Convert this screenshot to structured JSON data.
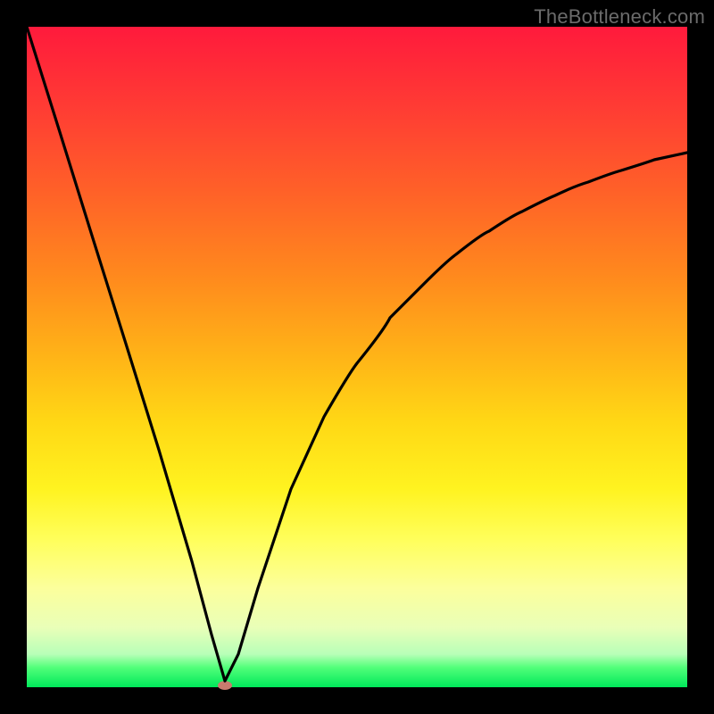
{
  "watermark": "TheBottleneck.com",
  "colors": {
    "frame_bg": "#000000",
    "curve_stroke": "#000000",
    "dot_fill": "#c97b6e",
    "gradient_top": "#ff1a3c",
    "gradient_bottom": "#00e85a"
  },
  "chart_data": {
    "type": "line",
    "title": "",
    "xlabel": "",
    "ylabel": "",
    "xlim": [
      0,
      100
    ],
    "ylim": [
      0,
      100
    ],
    "grid": false,
    "legend": false,
    "series": [
      {
        "name": "bottleneck-curve",
        "x": [
          0,
          5,
          10,
          15,
          20,
          25,
          28,
          30,
          32,
          35,
          40,
          45,
          50,
          55,
          60,
          65,
          70,
          75,
          80,
          85,
          90,
          95,
          100
        ],
        "y": [
          100,
          84,
          68,
          52,
          36,
          19,
          8,
          1,
          5,
          15,
          30,
          41,
          49,
          56,
          61,
          65.5,
          69,
          72,
          74.5,
          76.5,
          78.3,
          79.8,
          81
        ]
      }
    ],
    "marker": {
      "x": 30,
      "y": 0,
      "shape": "ellipse"
    },
    "background_gradient": {
      "direction": "vertical",
      "stops": [
        {
          "at": 0,
          "color": "#ff1a3c"
        },
        {
          "at": 50,
          "color": "#ffb417"
        },
        {
          "at": 78,
          "color": "#ffff5e"
        },
        {
          "at": 100,
          "color": "#00e85a"
        }
      ]
    }
  }
}
